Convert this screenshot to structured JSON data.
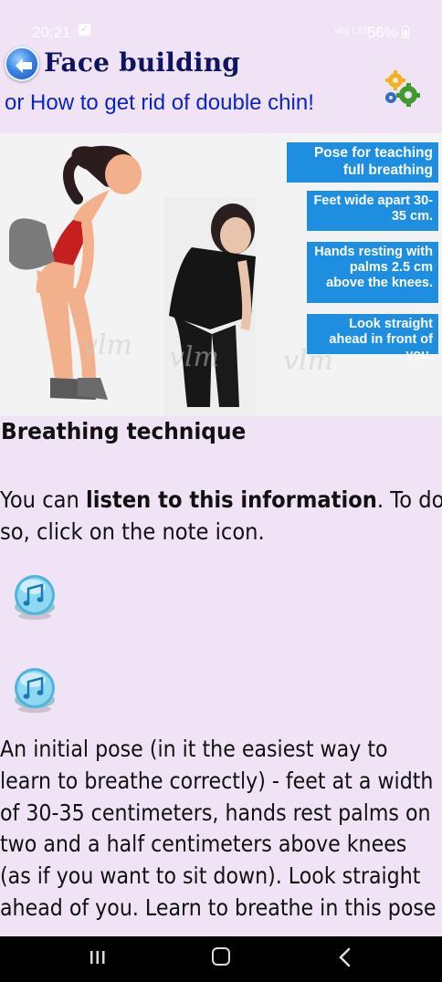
{
  "status_bar": {
    "time": "20:21",
    "signal": "Vo) LTE",
    "battery": "56%"
  },
  "header": {
    "title": "Face building",
    "subtitle": "or How to get rid of double chin!"
  },
  "illustration": {
    "boxes": [
      "Pose for teaching full breathing",
      "Feet wide apart 30-35 cm.",
      "Hands resting with palms 2.5 cm above the knees.",
      "Look straight ahead in front of you."
    ],
    "watermark": "vlm"
  },
  "content": {
    "section_title": "Breathing technique",
    "intro_pre": " You can ",
    "intro_bold": "listen to this information",
    "intro_post": ". To do",
    "intro_line2": "so, click on the note icon.",
    "body_lines": [
      "An initial pose (in it the easiest way to",
      "learn to breathe correctly) - feet at a width",
      "of 30-35 centimeters, hands rest palms on",
      "two and a half centimeters above knees",
      "(as if you want to sit down). Look straight",
      "ahead of you. Learn to breathe in this pose"
    ]
  },
  "icons": {
    "back": "back-arrow-icon",
    "settings": "gears-icon",
    "note": "music-note-icon"
  },
  "colors": {
    "background": "#efe3f5",
    "title": "#0d1563",
    "subtitle": "#0b24c9",
    "info_box": "#1e8fe0"
  }
}
